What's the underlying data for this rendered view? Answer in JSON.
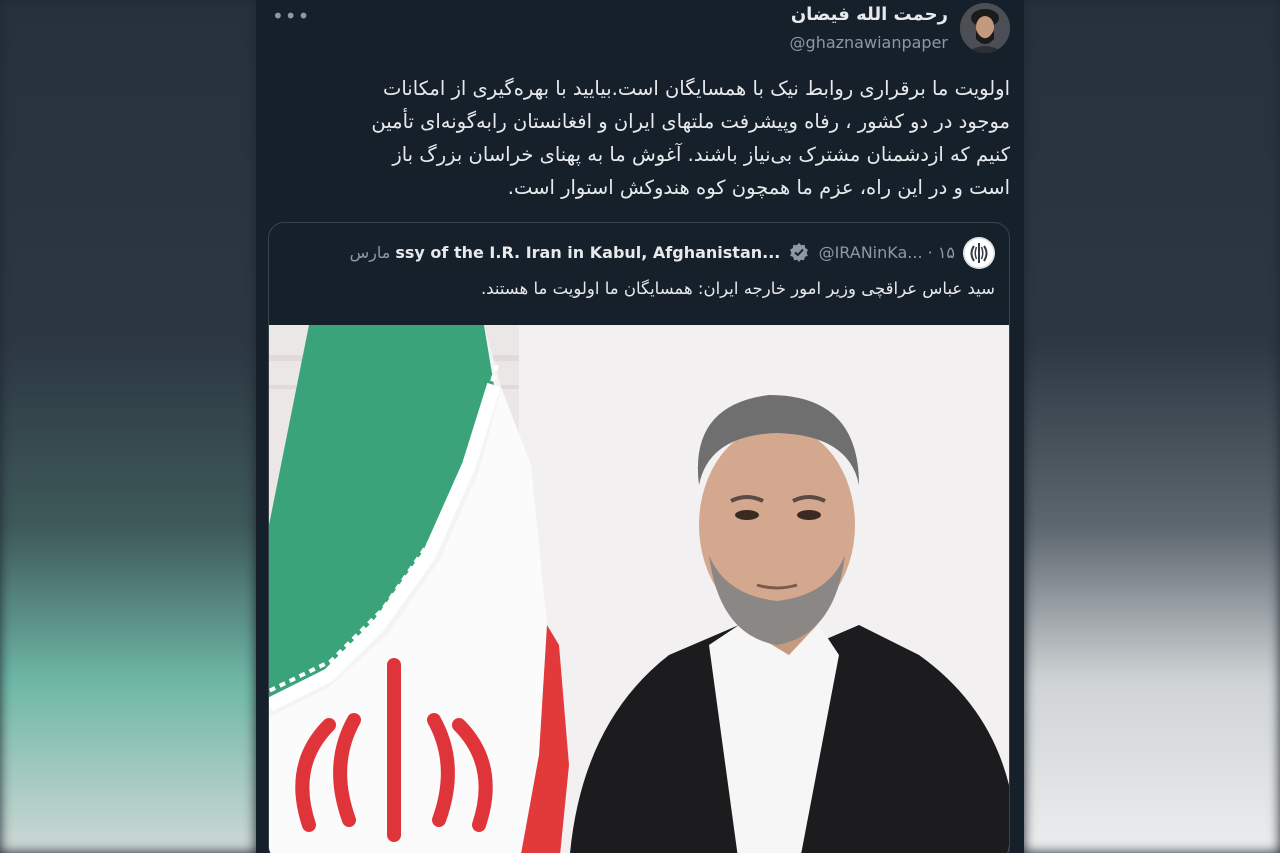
{
  "tweet": {
    "display_name": "رحمت الله فیضان",
    "handle": "@ghaznawianpaper",
    "more_icon": "ellipsis-icon",
    "body_lines": [
      "اولویت ما برقراری روابط نیک با همسایگان است.بیایید با بهره‌گیری از امکانات",
      "موجود در دو کشور ، رفاه وپیشرفت ملتهای ایران و افغانستان رابه‌گونه‌ای تأمین",
      "کنیم که ازدشمنان مشترک بی‌نیاز باشند. آغوش ما به پهنای خراسان بزرگ   باز",
      "است و در این راه، عزم ما همچون کوه هندوکش استوار است."
    ]
  },
  "quote": {
    "name": "ssy of the I.R. Iran in Kabul, Afghanistan...",
    "verified_icon": "verified-badge-icon",
    "handle": "@IRANinKa...",
    "separator": "·",
    "date": "۱۵ مارس",
    "text": "سید عباس عراقچی وزیر امور خارجه ایران: همسایگان ما اولویت ما هستند.",
    "image_alt": "portrait-with-flag"
  },
  "colors": {
    "tweet_bg": "#15202b",
    "text": "#e7e9ea",
    "muted": "#8b98a5",
    "border": "#38444d",
    "verified": "#8b98a5"
  }
}
